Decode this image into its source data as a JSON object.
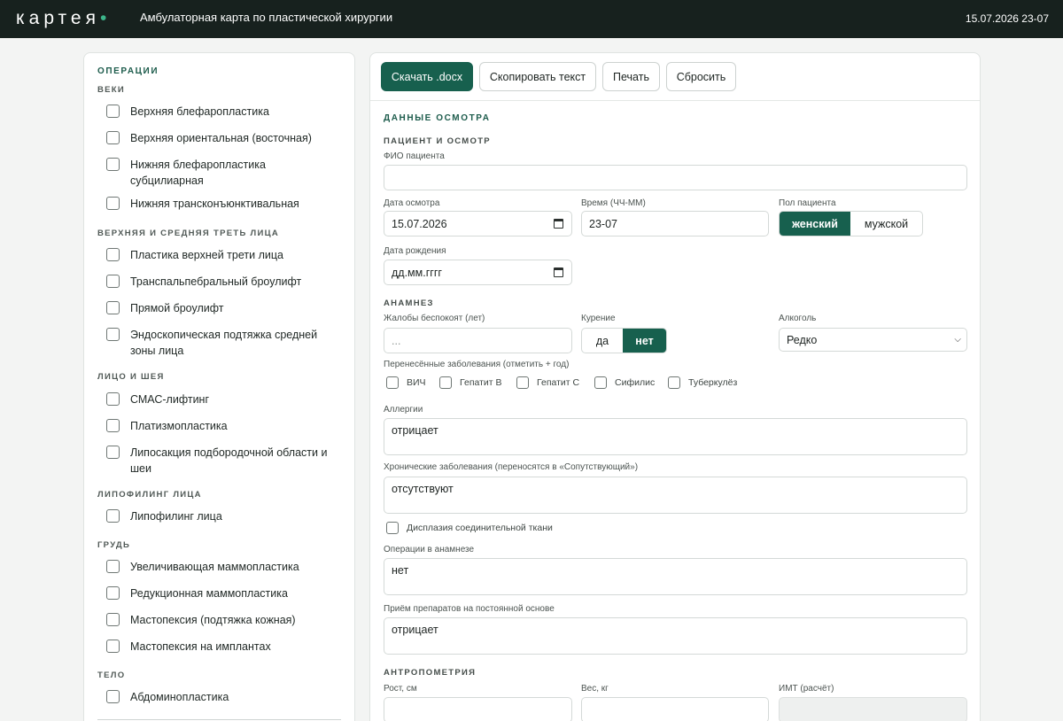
{
  "header": {
    "logo": "картея",
    "title": "Амбулаторная карта по пластической хирургии",
    "stamp": "15.07.2026 23-07"
  },
  "operations": {
    "title": "ОПЕРАЦИИ",
    "groups": [
      {
        "title": "ВЕКИ",
        "items": [
          "Верхняя блефаропластика",
          "Верхняя ориентальная (восточная)",
          "Нижняя блефаропластика субцилиарная",
          "Нижняя трансконъюнктивальная"
        ]
      },
      {
        "title": "ВЕРХНЯЯ И СРЕДНЯЯ ТРЕТЬ ЛИЦА",
        "items": [
          "Пластика верхней трети лица",
          "Транспальпебральный броулифт",
          "Прямой броулифт",
          "Эндоскопическая подтяжка средней зоны лица"
        ]
      },
      {
        "title": "ЛИЦО И ШЕЯ",
        "items": [
          "СМАС-лифтинг",
          "Платизмопластика",
          "Липосакция подбородочной области и шеи"
        ]
      },
      {
        "title": "ЛИПОФИЛИНГ ЛИЦА",
        "items": [
          "Липофилинг лица"
        ]
      },
      {
        "title": "ГРУДЬ",
        "items": [
          "Увеличивающая маммопластика",
          "Редукционная маммопластика",
          "Мастопексия (подтяжка кожная)",
          "Мастопексия на имплантах"
        ]
      },
      {
        "title": "ТЕЛО",
        "items": [
          "Абдоминопластика"
        ]
      }
    ]
  },
  "toolbar": {
    "download": "Скачать .docx",
    "copy": "Скопировать текст",
    "print": "Печать",
    "reset": "Сбросить"
  },
  "form": {
    "section_title": "ДАННЫЕ ОСМОТРА",
    "patient": {
      "title": "ПАЦИЕНТ И ОСМОТР",
      "fio_label": "ФИО пациента",
      "fio_value": "",
      "date_label": "Дата осмотра",
      "date_value": "15.07.2026",
      "time_label": "Время (ЧЧ-ММ)",
      "time_value": "23-07",
      "sex_label": "Пол пациента",
      "sex_options": [
        "женский",
        "мужской"
      ],
      "sex_selected": "женский",
      "birth_label": "Дата рождения",
      "birth_placeholder": "дд.мм.гггг"
    },
    "anamnesis": {
      "title": "АНАМНЕЗ",
      "complaints_label": "Жалобы беспокоят (лет)",
      "complaints_placeholder": "...",
      "smoking_label": "Курение",
      "smoking_options": [
        "да",
        "нет"
      ],
      "smoking_selected": "нет",
      "alcohol_label": "Алкоголь",
      "alcohol_value": "Редко",
      "diseases_label": "Перенесённые заболевания (отметить + год)",
      "diseases": [
        "ВИЧ",
        "Гепатит В",
        "Гепатит С",
        "Сифилис",
        "Туберкулёз"
      ],
      "allergy_label": "Аллергии",
      "allergy_value": "отрицает",
      "chronic_label": "Хронические заболевания (переносятся в «Сопутствующий»)",
      "chronic_value": "отсутствуют",
      "dysplasia_label": "Дисплазия соединительной ткани",
      "surgeries_label": "Операции в анамнезе",
      "surgeries_value": "нет",
      "meds_label": "Приём препаратов на постоянной основе",
      "meds_value": "отрицает"
    },
    "anthro": {
      "title": "АНТРОПОМЕТРИЯ",
      "height_label": "Рост, см",
      "weight_label": "Вес, кг",
      "bmi_label": "ИМТ (расчёт)"
    }
  }
}
